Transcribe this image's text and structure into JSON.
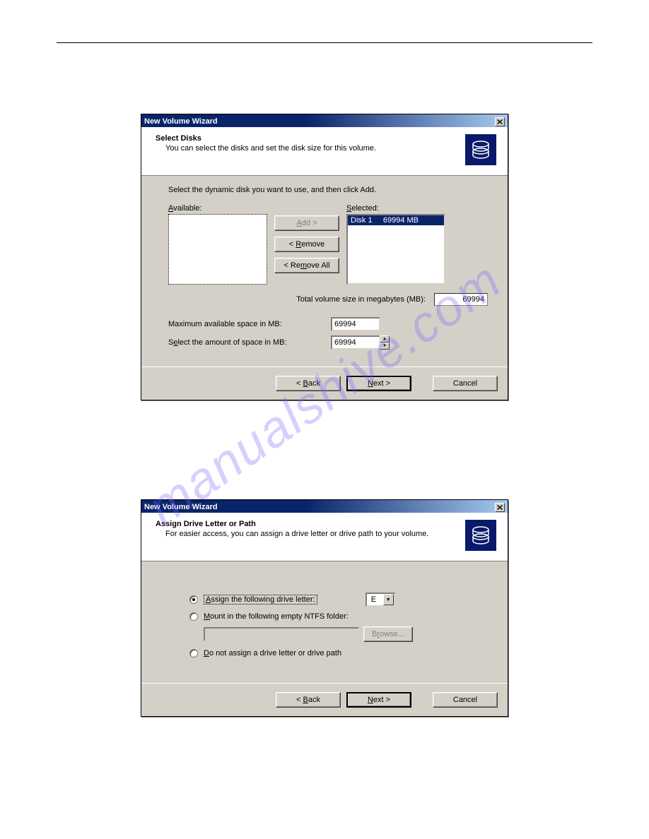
{
  "watermark": "manualshive.com",
  "dialog1": {
    "title": "New Volume Wizard",
    "header_title": "Select Disks",
    "header_sub": "You can select the disks and set the disk size for this volume.",
    "instruction": "Select the dynamic disk you want to use, and then click Add.",
    "available_label": "Available:",
    "selected_label": "Selected:",
    "selected_item": "Disk 1     69994 MB",
    "add_label": "Add >",
    "remove_label": "< Remove",
    "removeall_label": "< Remove All",
    "total_label": "Total volume size in megabytes (MB):",
    "total_value": "69994",
    "max_label": "Maximum available space in MB:",
    "max_value": "69994",
    "amount_label": "Select the amount of space in MB:",
    "amount_value": "69994",
    "back": "< Back",
    "next": "Next >",
    "cancel": "Cancel"
  },
  "dialog2": {
    "title": "New Volume Wizard",
    "header_title": "Assign Drive Letter or Path",
    "header_sub": "For easier access, you can assign a drive letter or drive path to your volume.",
    "opt_assign": "Assign the following drive letter:",
    "drive_value": "E",
    "opt_mount": "Mount in the following empty NTFS folder:",
    "browse": "Browse...",
    "opt_none": "Do not assign a drive letter or drive path",
    "back": "< Back",
    "next": "Next >",
    "cancel": "Cancel"
  }
}
